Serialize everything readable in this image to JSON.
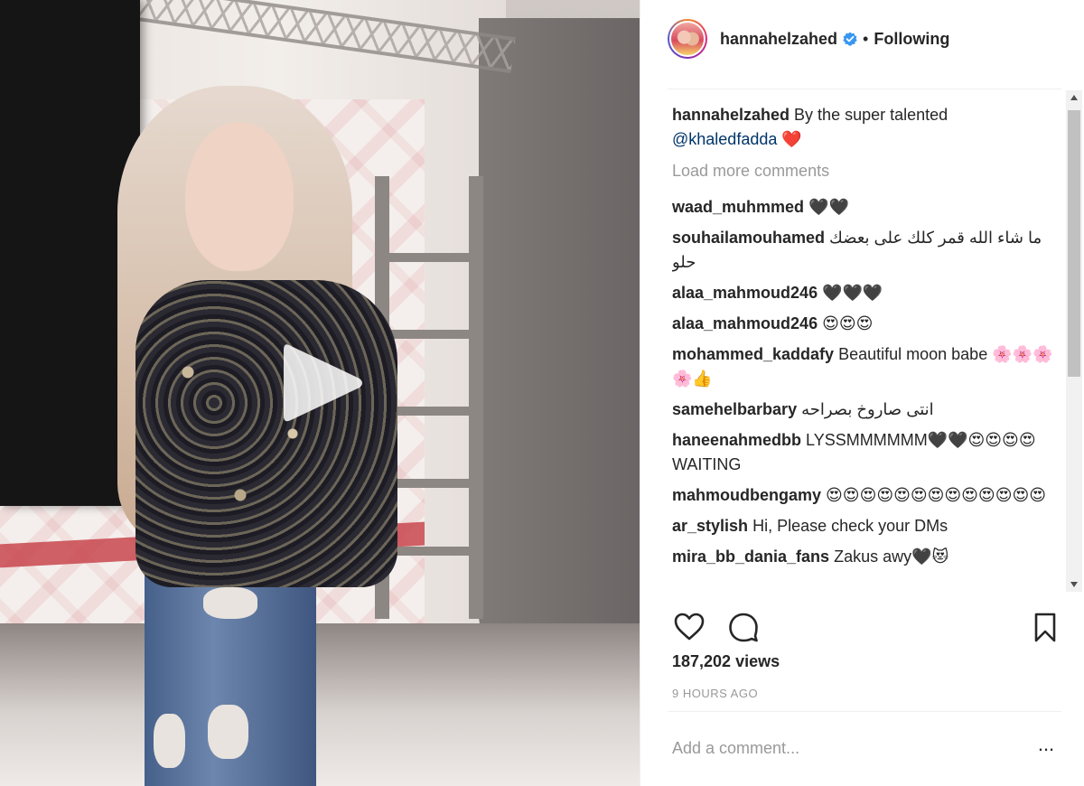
{
  "header": {
    "username": "hannahelzahed",
    "separator": "•",
    "follow_status": "Following"
  },
  "caption": {
    "user": "hannahelzahed",
    "text": "By the super talented",
    "mention": "@khaledfadda",
    "emoji": "❤️"
  },
  "load_more": "Load more comments",
  "comments": [
    {
      "user": "waad_muhmmed",
      "text": "🖤🖤"
    },
    {
      "user": "souhailamouhamed",
      "text": "ما شاء الله قمر كلك على بعضك حلو",
      "rtl": true
    },
    {
      "user": "alaa_mahmoud246",
      "text": "🖤🖤🖤"
    },
    {
      "user": "alaa_mahmoud246",
      "text": "😍😍😍"
    },
    {
      "user": "mohammed_kaddafy",
      "text": "Beautiful moon babe 🌸🌸🌸🌸👍"
    },
    {
      "user": "samehelbarbary",
      "text": "انتى صاروخ بصراحه",
      "rtl": true
    },
    {
      "user": "haneenahmedbb",
      "text": "LYSSMMMMMM🖤🖤😍😍😍😍WAITING"
    },
    {
      "user": "mahmoudbengamy",
      "text": "😍😍😍😍😍😍😍😍😍😍😍😍😍"
    },
    {
      "user": "ar_stylish",
      "text": "Hi, Please check your DMs"
    },
    {
      "user": "mira_bb_dania_fans",
      "text": "Zakus awy🖤😻"
    }
  ],
  "views": "187,202 views",
  "time_ago": "9 HOURS AGO",
  "comment_box": {
    "placeholder": "Add a comment..."
  },
  "more_options_label": "...",
  "icons": {
    "like": "heart-icon",
    "comment": "comment-bubble-icon",
    "save": "bookmark-icon",
    "play": "play-icon",
    "verified": "verified-badge-icon"
  },
  "colors": {
    "verified": "#3897f0",
    "mention": "#003569",
    "muted_text": "#999999",
    "heart": "#ed4956"
  }
}
